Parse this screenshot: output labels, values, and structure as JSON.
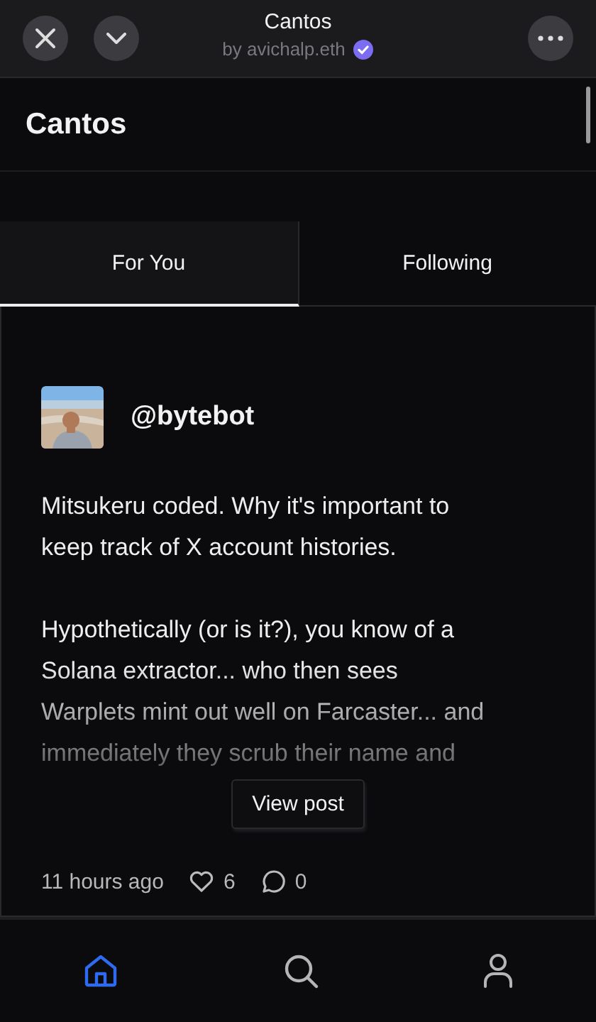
{
  "header": {
    "title": "Cantos",
    "subtitle": "by avichalp.eth",
    "verified": true
  },
  "page_title": "Cantos",
  "tabs": [
    {
      "label": "For You",
      "selected": true
    },
    {
      "label": "Following",
      "selected": false
    }
  ],
  "post": {
    "handle": "@bytebot",
    "paragraphs": [
      "Mitsukeru coded. Why it's important to keep track of X account histories.",
      "Hypothetically (or is it?), you know of a Solana extractor... who then sees Warplets mint out well on Farcaster... and immediately they scrub their name and"
    ],
    "view_button": "View post",
    "time": "11 hours ago",
    "likes": "6",
    "replies": "0"
  },
  "nav": [
    {
      "kind": "home",
      "selected": true
    },
    {
      "kind": "search",
      "selected": false
    },
    {
      "kind": "profile",
      "selected": false
    }
  ]
}
